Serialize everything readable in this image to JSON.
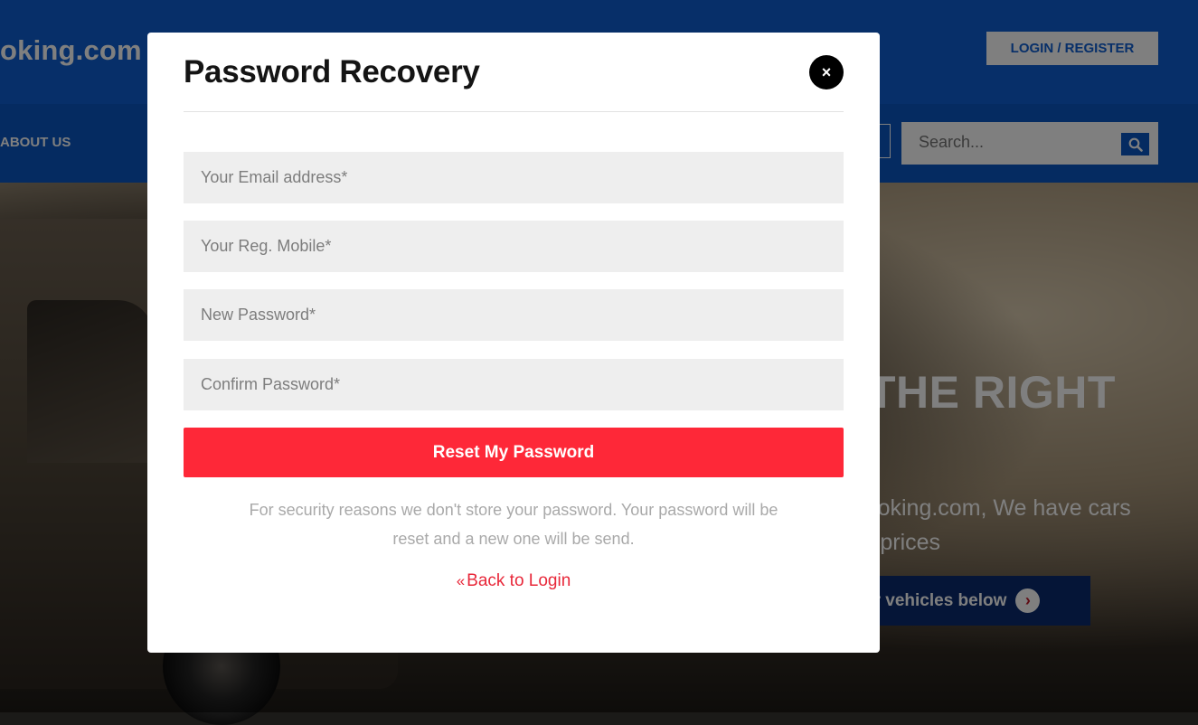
{
  "site": {
    "brand": "oking.com",
    "login_register": "LOGIN / REGISTER",
    "nav_about": "ABOUT US",
    "search_placeholder": "Search...",
    "hero_headline": "THE RIGHT",
    "hero_text_1": "Booking.com, We have cars",
    "hero_text_2": "tal prices",
    "hero_cta": "ur vehicles below",
    "colors": {
      "header_blue": "#0f5fd2",
      "nav_blue": "#0a56c2",
      "cta_navy": "#0a2a6e"
    }
  },
  "modal": {
    "title": "Password Recovery",
    "close_label": "×",
    "fields": [
      {
        "placeholder": "Your Email address*",
        "value": ""
      },
      {
        "placeholder": "Your Reg. Mobile*",
        "value": ""
      },
      {
        "placeholder": "New Password*",
        "value": ""
      },
      {
        "placeholder": "Confirm Password*",
        "value": ""
      }
    ],
    "submit_label": "Reset My Password",
    "note": "For security reasons we don't store your password. Your password will be reset and a new one will be send.",
    "back_label": "Back to Login",
    "back_icon": "double-chevron-left-icon",
    "colors": {
      "accent_red": "#fe2838",
      "link_red": "#e8283a",
      "field_bg": "#eeeeee"
    }
  }
}
